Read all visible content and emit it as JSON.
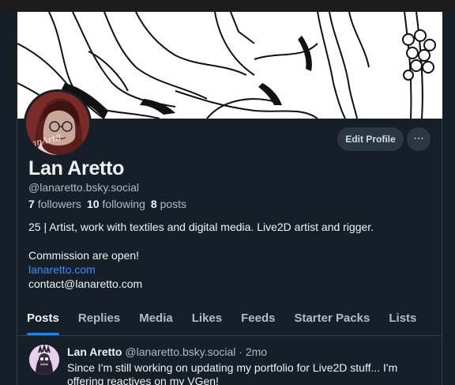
{
  "profile": {
    "display_name": "Lan Aretto",
    "handle": "@lanaretto.bsky.social",
    "followers_count": "7",
    "followers_label": "followers",
    "following_count": "10",
    "following_label": "following",
    "posts_count": "8",
    "posts_label": "posts",
    "avatar_signature": "lanaretto",
    "bio": {
      "line1": "25 | Artist, work with textiles and digital media. Live2D artist and rigger.",
      "line2": "Commission are open!",
      "link": "lanaretto.com",
      "email": "contact@lanaretto.com"
    }
  },
  "actions": {
    "edit_profile": "Edit Profile",
    "more": "···"
  },
  "tabs": [
    {
      "label": "Posts",
      "active": true
    },
    {
      "label": "Replies",
      "active": false
    },
    {
      "label": "Media",
      "active": false
    },
    {
      "label": "Likes",
      "active": false
    },
    {
      "label": "Feeds",
      "active": false
    },
    {
      "label": "Starter Packs",
      "active": false
    },
    {
      "label": "Lists",
      "active": false
    }
  ],
  "post": {
    "author": "Lan Aretto",
    "handle": "@lanaretto.bsky.social",
    "time": "· 2mo",
    "text": "Since I'm still working on updating my portfolio for Live2D stuff... I'm offering reactives on my VGen!"
  },
  "colors": {
    "background": "#161e27",
    "accent": "#1083fe",
    "link": "#3a8dff",
    "muted": "#aebbc9",
    "button_bg": "#2a3744"
  }
}
